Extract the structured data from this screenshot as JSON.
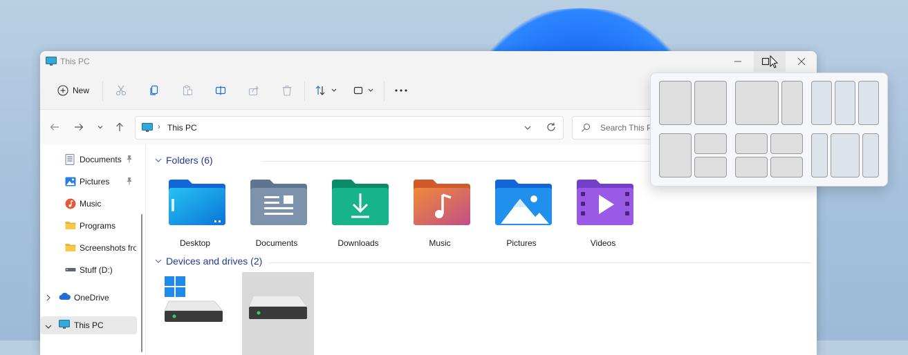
{
  "window": {
    "title": "This PC"
  },
  "toolbar": {
    "new_label": "New"
  },
  "address": {
    "path": "This PC",
    "search_placeholder": "Search This PC"
  },
  "sidebar": {
    "items": [
      {
        "label": "Documents",
        "icon": "documents-icon",
        "pinned": true
      },
      {
        "label": "Pictures",
        "icon": "pictures-icon",
        "pinned": true
      },
      {
        "label": "Music",
        "icon": "music-icon",
        "pinned": false
      },
      {
        "label": "Programs",
        "icon": "folder-icon",
        "pinned": false
      },
      {
        "label": "Screenshots fro",
        "icon": "folder-icon",
        "pinned": false
      },
      {
        "label": "Stuff (D:)",
        "icon": "drive-icon",
        "pinned": false
      },
      {
        "label": "OneDrive",
        "icon": "onedrive-icon",
        "pinned": false
      },
      {
        "label": "This PC",
        "icon": "this-pc-icon",
        "pinned": false
      }
    ]
  },
  "content": {
    "folders_header": "Folders (6)",
    "folders": [
      {
        "label": "Desktop"
      },
      {
        "label": "Documents"
      },
      {
        "label": "Downloads"
      },
      {
        "label": "Music"
      },
      {
        "label": "Pictures"
      },
      {
        "label": "Videos"
      }
    ],
    "drives_header": "Devices and drives (2)"
  },
  "colors": {
    "accent": "#1f3b8e",
    "selection": "#e8e8e8",
    "folder_blue": "#1a7de0",
    "folder_green": "#0f9f7a",
    "folder_purple": "#8c4ed8"
  }
}
